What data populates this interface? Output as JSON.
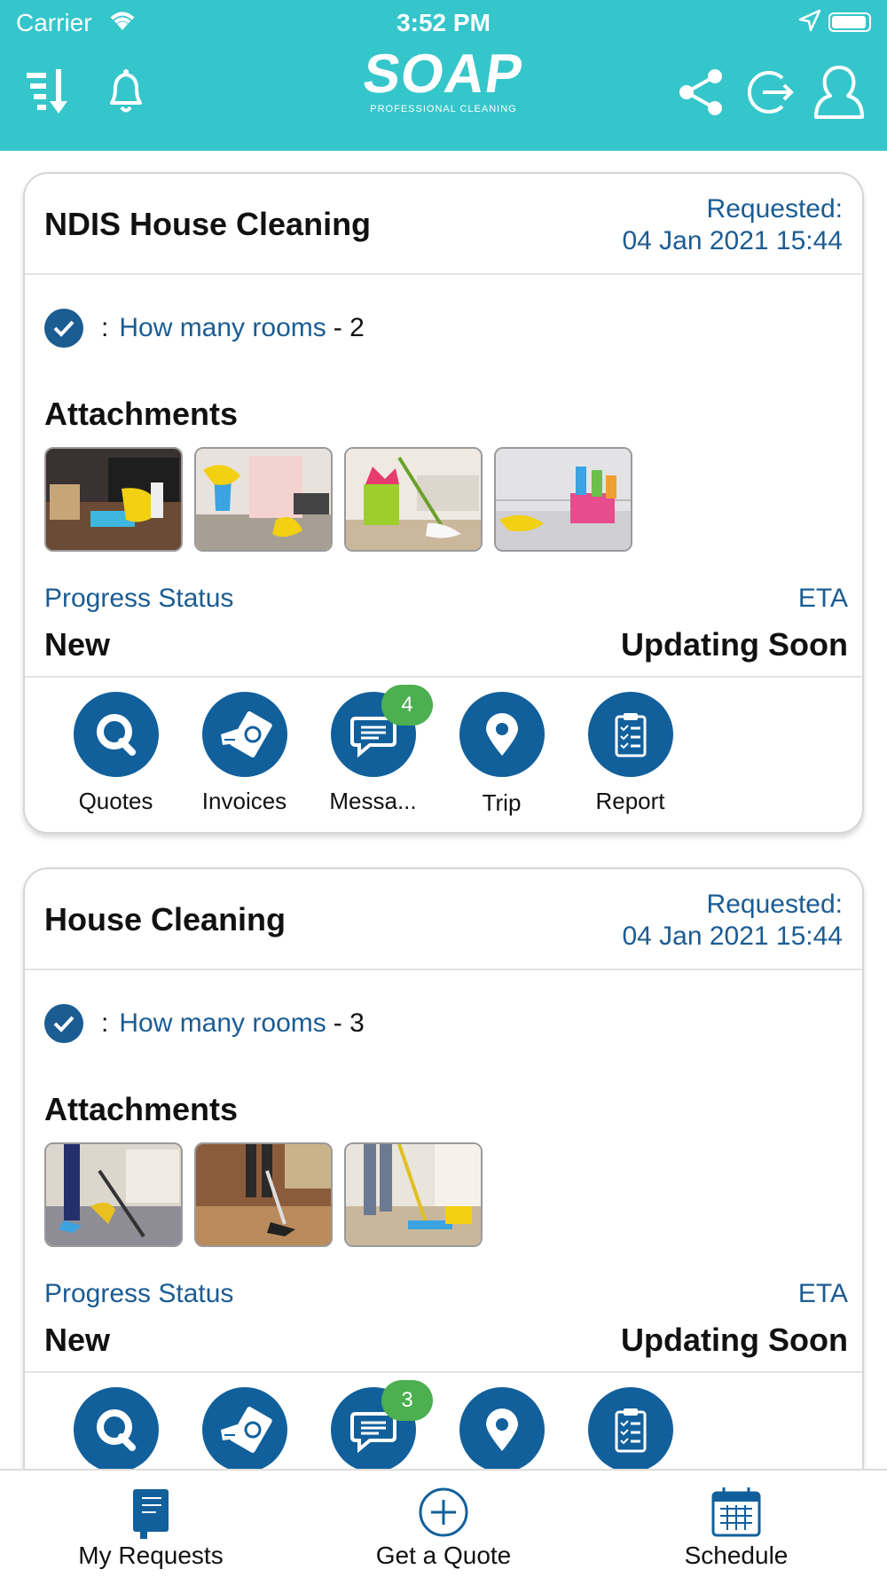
{
  "status_bar": {
    "carrier": "Carrier",
    "time": "3:52 PM"
  },
  "header": {
    "logo_main": "SOAP",
    "logo_sub": "PROFESSIONAL CLEANING"
  },
  "requests": [
    {
      "title": "NDIS House Cleaning",
      "requested_label": "Requested:",
      "requested_date": "04 Jan 2021 15:44",
      "question_sep": ":",
      "question": "How many rooms",
      "answer": "- 2",
      "attachments_label": "Attachments",
      "progress_label": "Progress Status",
      "progress_value": "New",
      "eta_label": "ETA",
      "eta_value": "Updating Soon",
      "actions": [
        "Quotes",
        "Invoices",
        "Messa...",
        "Trip",
        "Report"
      ],
      "message_badge": "4"
    },
    {
      "title": "House Cleaning",
      "requested_label": "Requested:",
      "requested_date": "04 Jan 2021 15:44",
      "question_sep": ":",
      "question": "How many rooms",
      "answer": "- 3",
      "attachments_label": "Attachments",
      "progress_label": "Progress Status",
      "progress_value": "New",
      "eta_label": "ETA",
      "eta_value": "Updating Soon",
      "message_badge": "3"
    }
  ],
  "tabs": {
    "my_requests": "My Requests",
    "get_quote": "Get a Quote",
    "schedule": "Schedule"
  },
  "colors": {
    "header": "#35c6cb",
    "primary": "#11609c",
    "link": "#1b5c93",
    "badge": "#4caf50"
  }
}
